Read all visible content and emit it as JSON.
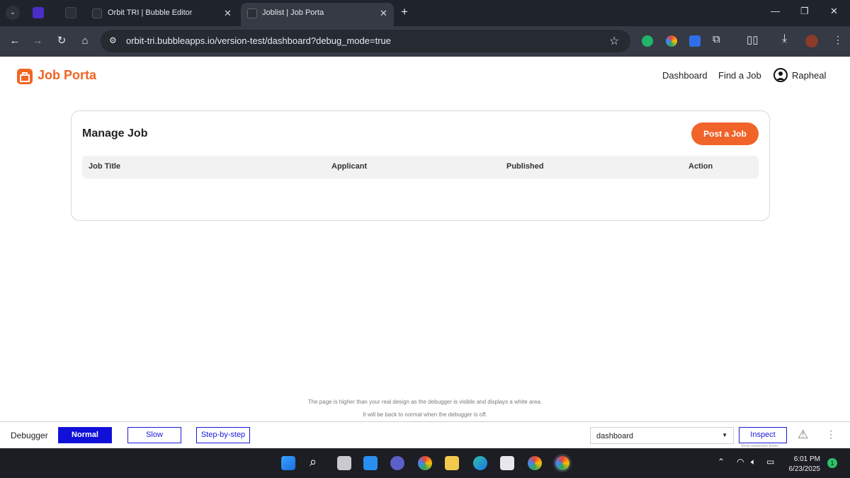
{
  "browser": {
    "tabs": [
      {
        "title": "Orbit TRI | Bubble Editor",
        "active": false
      },
      {
        "title": "Joblist | Job Porta",
        "active": true
      }
    ],
    "url": "orbit-tri.bubbleapps.io/version-test/dashboard?debug_mode=true",
    "accent": "#1f232b"
  },
  "header": {
    "brand": "Job Porta",
    "brand_color": "#ef6423",
    "nav": [
      "Dashboard",
      "Find a Job"
    ],
    "user": "Rapheal"
  },
  "main": {
    "title": "Manage Job",
    "post_button": "Post a Job",
    "button_color": "#f0642a",
    "columns": [
      "Job Title",
      "Applicant",
      "Published",
      "Action"
    ],
    "rows": []
  },
  "notice": {
    "line1": "The page is higher than your real design as the debugger is visible and displays a white area.",
    "line2": "It will be back to normal when the debugger is off."
  },
  "debugger": {
    "label": "Debugger",
    "modes": [
      "Normal",
      "Slow",
      "Step-by-step"
    ],
    "active_mode": "Normal",
    "page_select": "dashboard",
    "inspect": "Inspect",
    "inspect_hint": "Show responsive boxes"
  },
  "taskbar": {
    "time": "6:01 PM",
    "date": "6/23/2025",
    "notifications": "1"
  }
}
